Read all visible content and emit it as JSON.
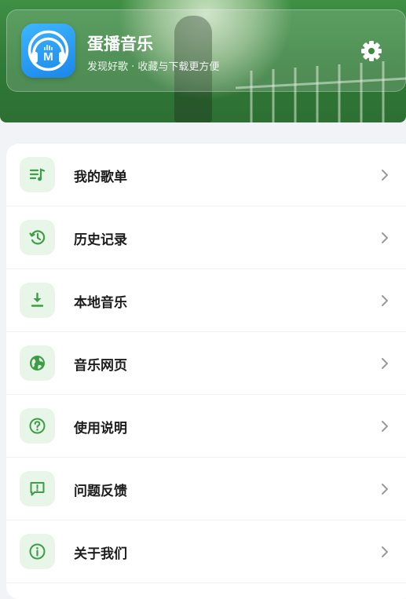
{
  "app": {
    "name": "蛋播音乐",
    "subtitle": "发现好歌 · 收藏与下载更方便"
  },
  "colors": {
    "accent": "#3f9d45",
    "icon_bg": "#e8f5e9",
    "logo": "#2a9bf5"
  },
  "menu": {
    "items": [
      {
        "label": "我的歌单",
        "icon": "playlist-icon"
      },
      {
        "label": "历史记录",
        "icon": "history-icon"
      },
      {
        "label": "本地音乐",
        "icon": "download-icon"
      },
      {
        "label": "音乐网页",
        "icon": "globe-icon"
      },
      {
        "label": "使用说明",
        "icon": "help-icon"
      },
      {
        "label": "问题反馈",
        "icon": "feedback-icon"
      },
      {
        "label": "关于我们",
        "icon": "info-icon"
      }
    ]
  }
}
